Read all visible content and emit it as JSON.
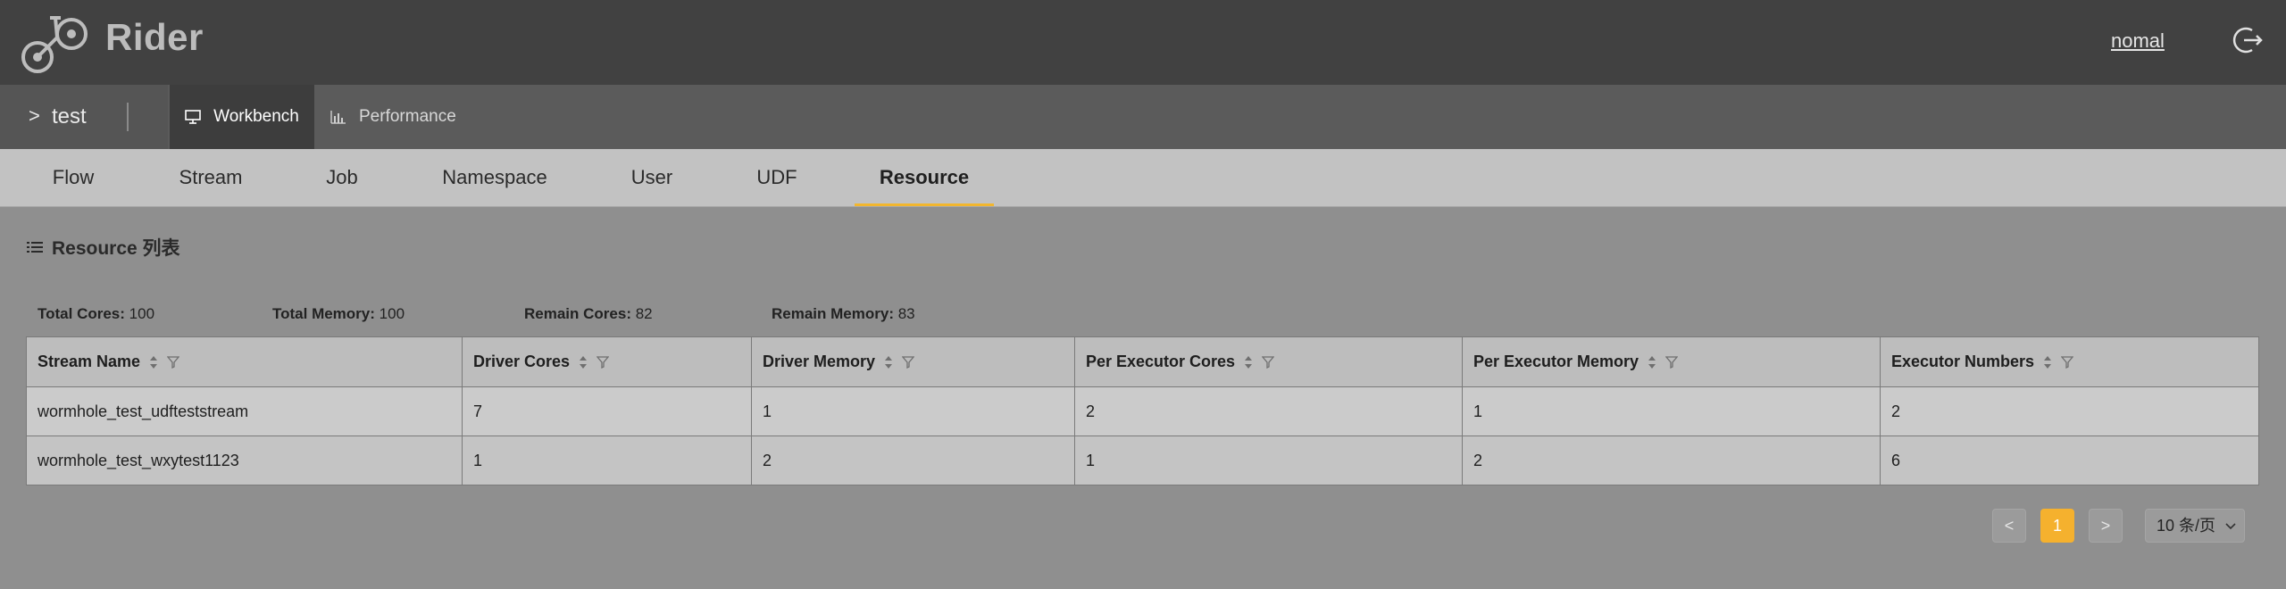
{
  "header": {
    "brand": "Rider",
    "user": "nomal"
  },
  "subbar": {
    "project_arrow": ">",
    "project_name": "test",
    "tabs": [
      {
        "label": "Workbench",
        "icon": "monitor-icon",
        "active": true
      },
      {
        "label": "Performance",
        "icon": "bar-chart-icon",
        "active": false
      }
    ]
  },
  "nav": {
    "tabs": [
      {
        "label": "Flow",
        "active": false
      },
      {
        "label": "Stream",
        "active": false
      },
      {
        "label": "Job",
        "active": false
      },
      {
        "label": "Namespace",
        "active": false
      },
      {
        "label": "User",
        "active": false
      },
      {
        "label": "UDF",
        "active": false
      },
      {
        "label": "Resource",
        "active": true
      }
    ]
  },
  "section": {
    "title": "Resource 列表"
  },
  "stats": {
    "total_cores_label": "Total Cores:",
    "total_cores": "100",
    "total_memory_label": "Total Memory:",
    "total_memory": "100",
    "remain_cores_label": "Remain Cores:",
    "remain_cores": "82",
    "remain_memory_label": "Remain Memory:",
    "remain_memory": "83"
  },
  "table": {
    "columns": [
      "Stream Name",
      "Driver Cores",
      "Driver Memory",
      "Per Executor Cores",
      "Per Executor Memory",
      "Executor Numbers"
    ],
    "rows": [
      [
        "wormhole_test_udfteststream",
        "7",
        "1",
        "2",
        "1",
        "2"
      ],
      [
        "wormhole_test_wxytest1123",
        "1",
        "2",
        "1",
        "2",
        "6"
      ]
    ]
  },
  "pagination": {
    "prev": "<",
    "current": "1",
    "next": ">",
    "page_size": "10 条/页"
  },
  "colors": {
    "accent": "#f2b62e",
    "header_bg": "#414141",
    "subbar_bg": "#5b5b5b",
    "nav_bg": "#c2c2c2",
    "content_bg": "#8f8f8f"
  }
}
